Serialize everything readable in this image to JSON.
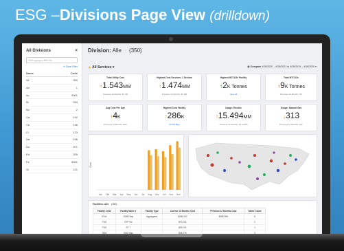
{
  "slide": {
    "title_part1": "ESG –",
    "title_part2": "Divisions Page View",
    "title_part3": "(drilldown)"
  },
  "sidebar": {
    "title": "All Divisions",
    "close": "×",
    "search_placeholder": "Start typing to filter list",
    "clear_label": "Clear Filter",
    "col_name": "Name",
    "col_code": "Code",
    "rows": [
      {
        "name": "All",
        "code": "350"
      },
      {
        "name": "Ab",
        "code": "1"
      },
      {
        "name": "Ac",
        "code": "5001"
      },
      {
        "name": "Bi",
        "code": "334"
      },
      {
        "name": "Bo",
        "code": "2"
      },
      {
        "name": "Ca",
        "code": "192"
      },
      {
        "name": "Ce",
        "code": "196"
      },
      {
        "name": "Ci",
        "code": "123"
      },
      {
        "name": "Da",
        "code": "166"
      },
      {
        "name": "Do",
        "code": "371"
      },
      {
        "name": "Ed",
        "code": "205"
      },
      {
        "name": "Fe",
        "code": "5001"
      },
      {
        "name": "Gi",
        "code": "121"
      }
    ]
  },
  "main": {
    "division_label": "Division:",
    "division_name": "Alle",
    "division_count": "(350)",
    "services_label": "All Services",
    "compare_label": "Compare",
    "compare_range": "4/26/2020 – 4/26/2021 to 4/26/2019 – 4/26/2020"
  },
  "kpis": [
    {
      "label": "Total Utility Cost",
      "arrow": "↑",
      "value": "1.543",
      "unit": "MM",
      "sub": "Previous 12 Months: $1.6M",
      "color": "#e08a10"
    },
    {
      "label": "Highest Cost Services: 1 Sectors",
      "arrow": "↑",
      "value": "1.474",
      "unit": "MM",
      "sub": "Previous 12 Months: $1.6M",
      "color": "#e08a10"
    },
    {
      "label": "Highest MTCO2e Facility",
      "arrow": "↑",
      "value": "2",
      "unit": "K Tonnes",
      "sub": "View All",
      "color": "#2e9a3a"
    },
    {
      "label": "Total MTCO2e",
      "arrow": "↑",
      "value": "9",
      "unit": "K Tonnes",
      "sub": "Previous 12 Months: 9K",
      "color": "#e04a2a"
    },
    {
      "label": "Avg Cost Per Day",
      "arrow": "↑",
      "value": "4",
      "unit": "K",
      "sub": "Previous 12 Months: $4K",
      "color": "#e08a10"
    },
    {
      "label": "Highest Cost Facility",
      "arrow": "↑",
      "value": "286",
      "unit": "K",
      "sub": "(STAR Bay)",
      "color": "#e08a10"
    },
    {
      "label": "Usage: Electric",
      "arrow": "↑",
      "value": "15.494",
      "unit": "MM",
      "sub": "Previous 12 Months: 15.4 kWh",
      "color": "#e08a10"
    },
    {
      "label": "Usage: Natural Gas",
      "arrow": "↓",
      "value": "313",
      "unit": "",
      "sub": "Previous 12 Months: 312",
      "color": "#e08a10"
    }
  ],
  "chart_data": {
    "type": "bar",
    "categories": [
      "Jan",
      "Feb",
      "Mar",
      "Apr",
      "May",
      "Jun",
      "Jul",
      "Aug",
      "Sep",
      "Oct",
      "Nov",
      "Dec"
    ],
    "series": [
      {
        "values": [
          0,
          0,
          0,
          0,
          0,
          0,
          0,
          80,
          82,
          78,
          90,
          98
        ]
      },
      {
        "values": [
          0,
          0,
          0,
          0,
          0,
          0,
          0,
          70,
          68,
          66,
          72,
          85
        ]
      }
    ],
    "ylim": [
      0,
      100
    ],
    "colors": [
      "#f0a020",
      "#e8c070"
    ],
    "ylabel": "Cost"
  },
  "table": {
    "caption_label": "Facilities: Alle",
    "caption_count": "(350)",
    "headers": [
      "Facility Code",
      "Facility Name ▾",
      "Facility Type",
      "Current 12 Months Cost",
      "Previous 12 Months Cost",
      "Meter Count"
    ],
    "rows": [
      [
        "9744",
        "STAR Bay",
        "Aggregates",
        "$286,442",
        "$288,996",
        "8"
      ],
      [
        "7742",
        "STP Rd",
        "",
        "$70,231",
        "",
        "2"
      ],
      [
        "7742",
        "ST 7",
        "",
        "$29,241",
        "",
        "1"
      ],
      [
        "7804",
        "SMO Bay",
        "",
        "$28,275",
        "",
        "3"
      ]
    ]
  },
  "map": {
    "label": "United States"
  }
}
